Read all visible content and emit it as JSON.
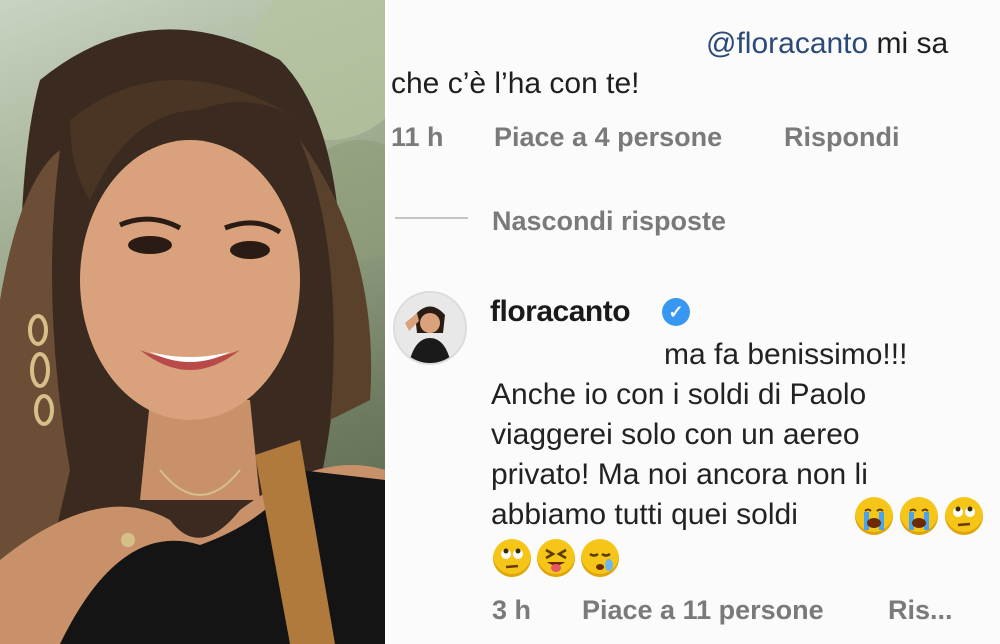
{
  "comment_top": {
    "mention": "@floracanto",
    "line1_rest": " mi sa",
    "line2": "che c’è l’ha con te!",
    "time": "11 h",
    "likes": "Piace a 4 persone",
    "reply": "Rispondi"
  },
  "hide_replies": "Nascondi risposte",
  "reply_comment": {
    "username": "floracanto",
    "verified_icon": "verified-badge-icon",
    "lines": [
      "ma fa benissimo!!!",
      "Anche io con i soldi di Paolo",
      "viaggerei solo con un aereo",
      "privato! Ma noi ancora non li",
      "abbiamo tutti quei soldi"
    ],
    "emojis_line1": [
      "loudly-crying-face",
      "loudly-crying-face",
      "rolling-eyes-face"
    ],
    "emojis_line2": [
      "rolling-eyes-face",
      "squinting-tongue-face",
      "sleepy-face"
    ],
    "time": "3 h",
    "likes": "Piace a 11 persone",
    "reply": "Ris..."
  },
  "colors": {
    "mention": "#2c4a78",
    "meta": "#7a7a7a",
    "verified": "#3897f0"
  }
}
